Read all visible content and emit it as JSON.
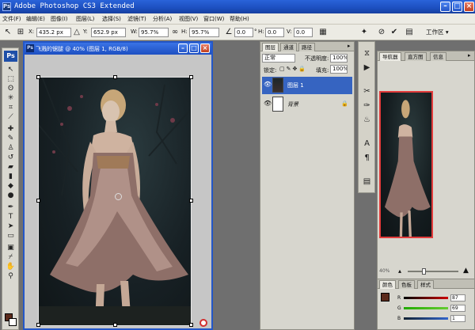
{
  "app": {
    "title": "Adobe Photoshop CS3 Extended",
    "icon": "Ps"
  },
  "menus": [
    "文件(F)",
    "编辑(E)",
    "图像(I)",
    "图层(L)",
    "选择(S)",
    "滤镜(T)",
    "分析(A)",
    "视图(V)",
    "窗口(W)",
    "帮助(H)"
  ],
  "options": {
    "x_label": "X:",
    "x_value": "435.2 px",
    "y_label": "Y:",
    "y_value": "652.9 px",
    "w_label": "W:",
    "w_value": "95.7%",
    "h_label": "H:",
    "h_value": "95.7%",
    "angle_value": "0.0",
    "hskew_label": "H:",
    "hskew_value": "0.0",
    "vskew_label": "V:",
    "vskew_value": "0.0",
    "workspace_label": "工作区 ▾"
  },
  "document": {
    "title": "飞溅的锯腿 @ 40% (图层 1, RGB/8)"
  },
  "layers_panel": {
    "tabs": [
      "图层",
      "通道",
      "路径"
    ],
    "blend_mode": "正常",
    "opacity_label": "不透明度:",
    "opacity_value": "100%",
    "lock_label": "锁定:",
    "fill_label": "填充:",
    "fill_value": "100%",
    "layers": [
      {
        "name": "图层 1",
        "selected": true
      },
      {
        "name": "背景",
        "selected": false
      }
    ]
  },
  "navigator": {
    "tabs": [
      "导航器",
      "直方图",
      "信息"
    ],
    "zoom_value": "40%"
  },
  "color_panel": {
    "tabs": [
      "颜色",
      "色板",
      "样式"
    ],
    "r_value": "87",
    "g_value": "69",
    "b_value": "1",
    "foreground": "#5b2a1b"
  }
}
